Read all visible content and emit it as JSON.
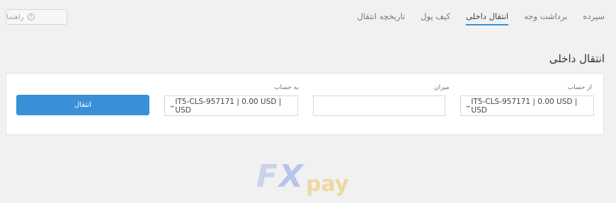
{
  "help_button": {
    "label": "راهنما",
    "icon": "help-circle-icon"
  },
  "tabs": [
    {
      "label": "سپرده",
      "active": false
    },
    {
      "label": "برداشت وجه",
      "active": false
    },
    {
      "label": "انتقال داخلی",
      "active": true
    },
    {
      "label": "کیف پول",
      "active": false
    },
    {
      "label": "تاریخچه انتقال",
      "active": false
    }
  ],
  "page_title": "انتقال داخلی",
  "form": {
    "from_account": {
      "label": "از حساب",
      "value": "IT5-CLS-957171 | 0.00 USD | USD"
    },
    "amount": {
      "label": "میزان",
      "value": ""
    },
    "to_account": {
      "label": "به حساب",
      "value": "IT5-CLS-957171 | 0.00 USD | USD"
    },
    "submit_label": "انتقال"
  },
  "watermark": {
    "brand": "FXpay"
  },
  "colors": {
    "accent": "#3a90d6",
    "watermark_blue": "#c9d2ef",
    "watermark_gold": "#ecd9a0"
  }
}
